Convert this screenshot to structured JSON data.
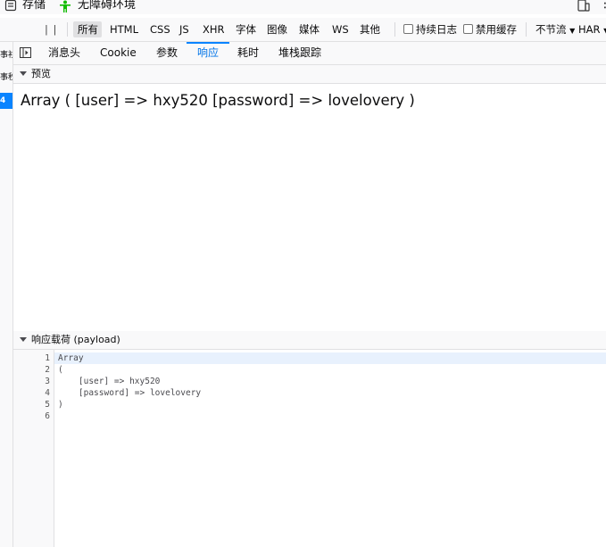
{
  "toolbar_top": {
    "storage_label": "存储",
    "accessibility_label": "无障碍环境"
  },
  "filters": {
    "pause_icon": "pause-icon",
    "items": [
      "所有",
      "HTML",
      "CSS",
      "JS",
      "XHR",
      "字体",
      "图像",
      "媒体",
      "WS",
      "其他"
    ],
    "persist_logs": "持续日志",
    "disable_cache": "禁用缓存",
    "throttle": "不节流",
    "har": "HAR"
  },
  "left_strip": [
    "事衫",
    "事秒",
    "4"
  ],
  "tabs": {
    "headers": "消息头",
    "cookie": "Cookie",
    "params": "参数",
    "response": "响应",
    "timings": "耗时",
    "stack": "堆栈跟踪"
  },
  "preview": {
    "section": "预览",
    "text": "Array ( [user] => hxy520 [password] => lovelovery )"
  },
  "payload": {
    "section": "响应载荷 (payload)",
    "lines": [
      "Array",
      "(",
      "    [user] => hxy520",
      "    [password] => lovelovery",
      ")",
      ""
    ],
    "line_numbers": [
      "1",
      "2",
      "3",
      "4",
      "5",
      "6"
    ]
  },
  "colors": {
    "accent": "#0a84ff",
    "toolbar_bg": "#f9f9fa",
    "border": "#e0e0e2"
  }
}
